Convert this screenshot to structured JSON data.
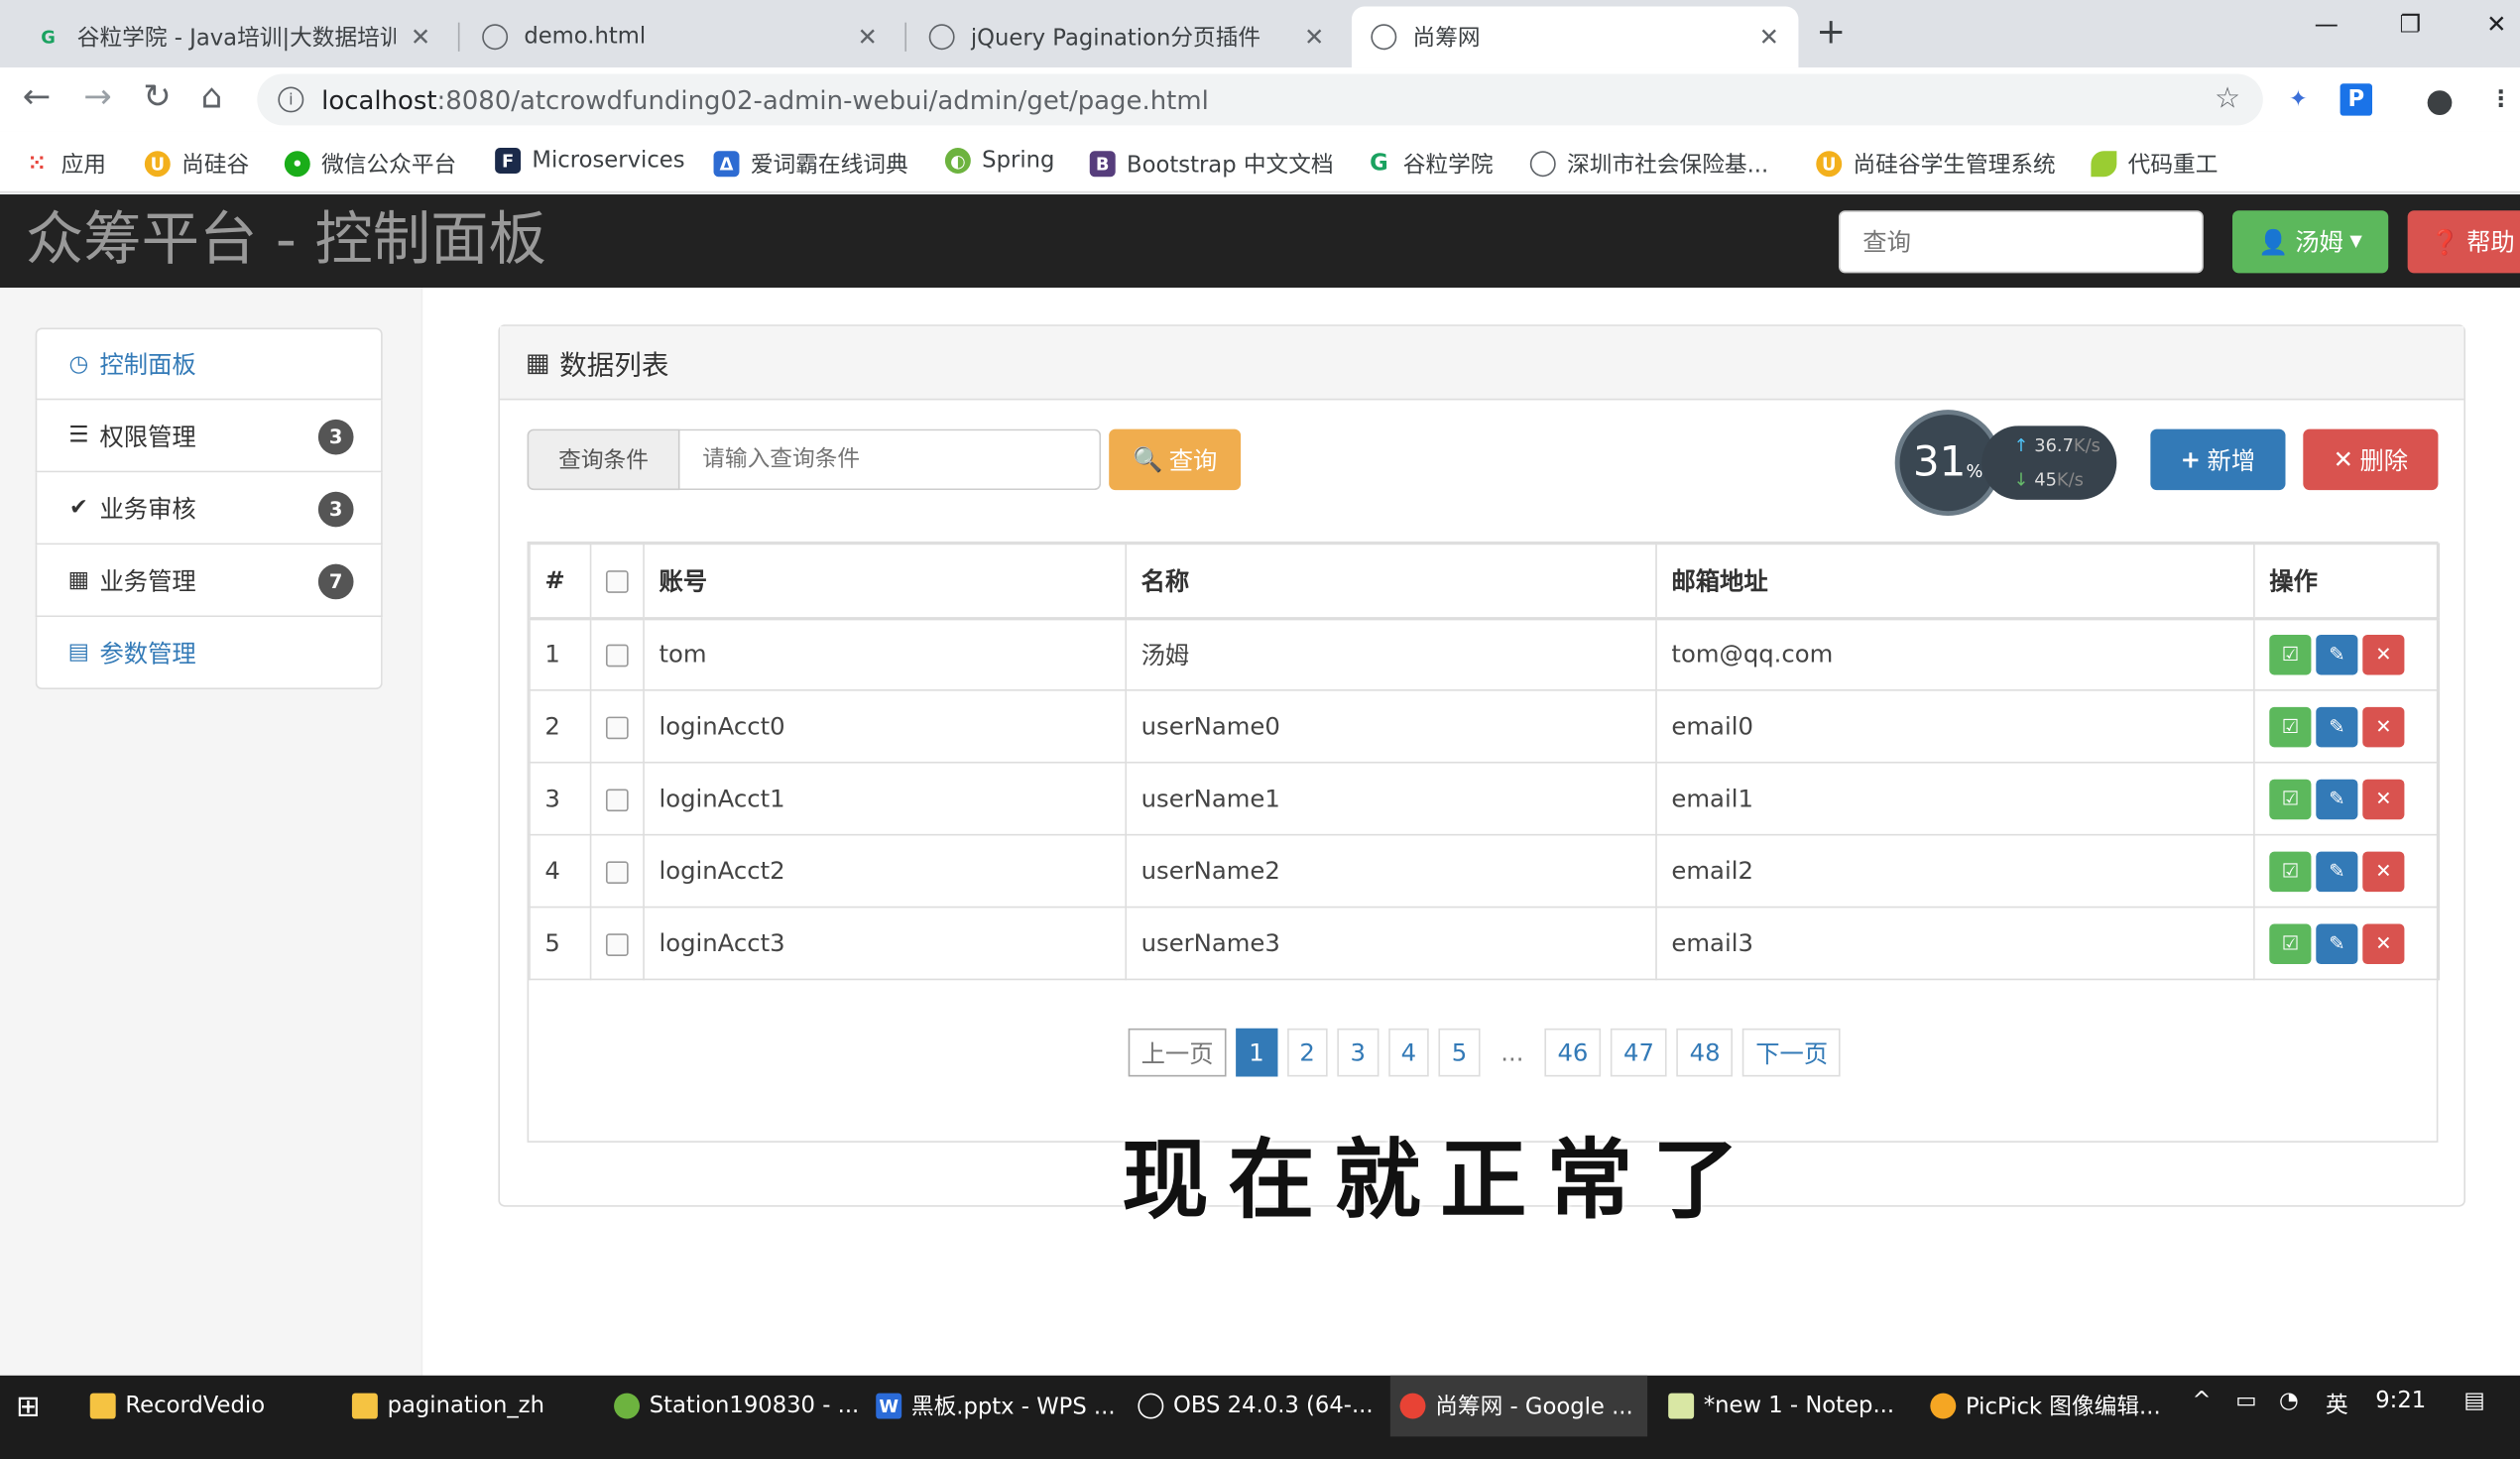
{
  "browser": {
    "tabs": [
      {
        "title": "谷粒学院 - Java培训|大数据培训",
        "icon": "guli-icon"
      },
      {
        "title": "demo.html",
        "icon": "globe-icon"
      },
      {
        "title": "jQuery Pagination分页插件",
        "icon": "globe-icon"
      },
      {
        "title": "尚筹网",
        "icon": "globe-icon",
        "active": true
      }
    ],
    "new_tab": "+",
    "url_host": "localhost",
    "url_path": ":8080/atcrowdfunding02-admin-webui/admin/get/page.html",
    "bookmarks": [
      {
        "label": "应用"
      },
      {
        "label": "尚硅谷"
      },
      {
        "label": "微信公众平台"
      },
      {
        "label": "Microservices"
      },
      {
        "label": "爱词霸在线词典"
      },
      {
        "label": "Spring"
      },
      {
        "label": "Bootstrap 中文文档"
      },
      {
        "label": "谷粒学院"
      },
      {
        "label": "深圳市社会保险基..."
      },
      {
        "label": "尚硅谷学生管理系统"
      },
      {
        "label": "代码重工"
      }
    ]
  },
  "navbar": {
    "brand": "众筹平台 - 控制面板",
    "search_placeholder": "查询",
    "user_label": "汤姆",
    "help_label": "帮助"
  },
  "sidebar": {
    "items": [
      {
        "label": "控制面板",
        "icon": "dashboard-icon",
        "badge": ""
      },
      {
        "label": "权限管理",
        "icon": "tasks-icon",
        "badge": "3"
      },
      {
        "label": "业务审核",
        "icon": "ok-icon",
        "badge": "3"
      },
      {
        "label": "业务管理",
        "icon": "th-large-icon",
        "badge": "7"
      },
      {
        "label": "参数管理",
        "icon": "list-alt-icon",
        "badge": ""
      }
    ]
  },
  "panel": {
    "title": "数据列表",
    "query_addon": "查询条件",
    "query_placeholder": "请输入查询条件",
    "query_button": "查询",
    "add_button": "新增",
    "delete_button": "删除",
    "speed": {
      "percent": "31",
      "unit": "%",
      "up": "36.7",
      "down": "45",
      "rate_unit": "K/s"
    }
  },
  "table": {
    "headers": [
      "#",
      "",
      "账号",
      "名称",
      "邮箱地址",
      "操作"
    ],
    "rows": [
      {
        "num": "1",
        "account": "tom",
        "name": "汤姆",
        "email": "tom@qq.com"
      },
      {
        "num": "2",
        "account": "loginAcct0",
        "name": "userName0",
        "email": "email0"
      },
      {
        "num": "3",
        "account": "loginAcct1",
        "name": "userName1",
        "email": "email1"
      },
      {
        "num": "4",
        "account": "loginAcct2",
        "name": "userName2",
        "email": "email2"
      },
      {
        "num": "5",
        "account": "loginAcct3",
        "name": "userName3",
        "email": "email3"
      }
    ]
  },
  "pagination": {
    "prev": "上一页",
    "pages": [
      "1",
      "2",
      "3",
      "4",
      "5"
    ],
    "ellipsis": "...",
    "tail_pages": [
      "46",
      "47",
      "48"
    ],
    "next": "下一页",
    "current": "1"
  },
  "subtitle": "现在就正常了",
  "taskbar": {
    "items": [
      {
        "label": "RecordVedio"
      },
      {
        "label": "pagination_zh"
      },
      {
        "label": "Station190830 - ..."
      },
      {
        "label": "黑板.pptx - WPS ..."
      },
      {
        "label": "OBS 24.0.3 (64-..."
      },
      {
        "label": "尚筹网 - Google ..."
      },
      {
        "label": "*new 1 - Notep..."
      },
      {
        "label": "PicPick 图像编辑..."
      }
    ],
    "ime": "英",
    "time": "9:21"
  }
}
